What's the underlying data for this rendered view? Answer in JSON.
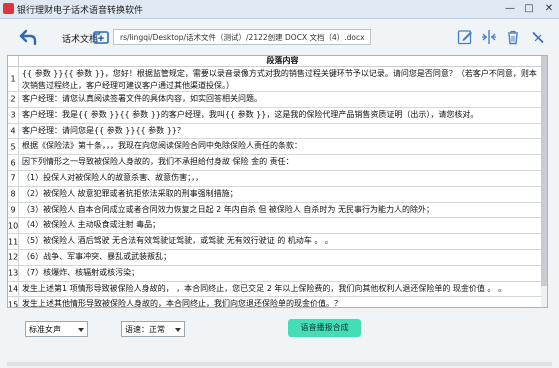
{
  "window": {
    "title": "银行理财电子话术语音转换软件",
    "minimize": "—",
    "maximize": "□",
    "close": "✕"
  },
  "toolbar": {
    "file_label": "话术文档",
    "file_path": "rs/lingqi/Desktop/话术文件（测试）/2122创建 DOCX 文档（4）.docx"
  },
  "table": {
    "header": "段落内容",
    "rows": [
      {
        "idx": "1",
        "text": "{{ 参数 }}{{ 参数 }}，您好！根据监管规定，需要以录音录像方式对我的销售过程关键环节予以记录。请问您是否同意？（若客户不同意，则本次销售过程终止，客户经理可建议客户通过其他渠道投保。）"
      },
      {
        "idx": "2",
        "text": "客户经理：请您认真阅读签署文件的具体内容，如实回答相关问题。"
      },
      {
        "idx": "3",
        "text": "客户经理：我是{{ 参数 }}{{ 参数 }}的客户经理，我叫{{ 参数 }}，这是我的保险代理产品销售资质证明（出示），请您核对。"
      },
      {
        "idx": "4",
        "text": "客户经理：请问您是{{ 参数 }}{{ 参数 }}？"
      },
      {
        "idx": "5",
        "text": "根据《保险法》第十条，，，我现在向您阅读保险合同中免除保险人责任的条款："
      },
      {
        "idx": "6",
        "text": "因下列情形之一导致被保险人身故的，我们不承担给付身故 保险 金的 责任："
      },
      {
        "idx": "7",
        "text": "（1）投保人对被保险人的故意杀害、故意伤害；，，"
      },
      {
        "idx": "8",
        "text": "（2）被保险人 故意犯罪或者抗拒依法采取的刑事强制措施；"
      },
      {
        "idx": "9",
        "text": "（3）被保险人 自本合同成立或者合同效力恢复之日起 2 年内自杀 但 被保险人 自杀时为 无民事行为能力人的除外；"
      },
      {
        "idx": "10",
        "text": "（4）被保险人 主动吸食或注射 毒品；"
      },
      {
        "idx": "11",
        "text": "（5）被保险人 酒后驾驶 无合法有效驾驶证驾驶，或驾驶 无有效行驶证 的 机动车 。 。"
      },
      {
        "idx": "12",
        "text": "（6）战争、军事冲突、暴乱或武装叛乱；"
      },
      {
        "idx": "13",
        "text": "（7）核爆炸、核辐射或核污染；"
      },
      {
        "idx": "14",
        "text": "发生上述第1 项情形导致被保险人身故的， ，本合同终止，您已交足 2 年以上保险费的，我们向其他权利人退还保险单的 现金价值 。 。"
      },
      {
        "idx": "15",
        "text": "发生上述其他情形导致被保险人身故的，本合同终止，我们向您退还保险单的现金价值。？"
      }
    ]
  },
  "controls": {
    "voice_select": "标准女声",
    "speed_select": "语速：正常",
    "synth_button": "语音播报合成"
  },
  "colors": {
    "accent_blue": "#2b6cb3",
    "synth_button": "#44ddb6",
    "app_icon": "#d9363e"
  }
}
